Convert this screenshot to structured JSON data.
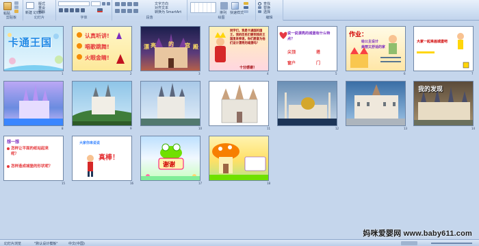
{
  "ribbon": {
    "groups": [
      "剪贴板",
      "幻灯片",
      "字体",
      "段落",
      "绘图",
      "编辑"
    ],
    "paste_label": "粘贴",
    "new_slide_label": "新建\n幻灯片",
    "layout_label": "版式",
    "reset_label": "重设",
    "delete_label": "删除",
    "font_name": "",
    "font_size": "",
    "text_direction_label": "文字方向",
    "align_text_label": "对齐文本",
    "smartart_label": "转换为 SmartArt",
    "shapes_label": "形状",
    "arrange_label": "排列",
    "quick_styles_label": "快速样式",
    "find_label": "查找",
    "replace_label": "替换",
    "select_label": "选择"
  },
  "slides": [
    {
      "num": "1",
      "title": "卡通王国"
    },
    {
      "num": "2",
      "texts": [
        "认真听讲!",
        "唱歌跳舞!",
        "火眼金睛!"
      ]
    },
    {
      "num": "3",
      "texts": [
        "漂",
        "亮",
        "的",
        "宫",
        "殿"
      ]
    },
    {
      "num": "4",
      "texts": [
        "同学们，我是卡通国的国王，我的臣民们要到我的王国里来参观，你们愿意为他们设计漂亮的城堡吗？",
        "十分感谢！"
      ]
    },
    {
      "num": "5",
      "texts": [
        "说一说漂亮的城堡有什么特点？",
        "尖顶",
        "塔",
        "窗户",
        "门"
      ]
    },
    {
      "num": "6",
      "texts": [
        "作业：",
        "给公主设计",
        "美丽又舒适的家"
      ]
    },
    {
      "num": "7",
      "texts": [
        "大家一起来画城堡吧"
      ]
    },
    {
      "num": "8"
    },
    {
      "num": "9"
    },
    {
      "num": "10"
    },
    {
      "num": "11"
    },
    {
      "num": "12"
    },
    {
      "num": "13"
    },
    {
      "num": "14",
      "texts": [
        "我的发现"
      ]
    },
    {
      "num": "15",
      "texts": [
        "想一想",
        "怎样让平面的纸站起来呢？",
        "怎样造成城堡的形状呢？"
      ]
    },
    {
      "num": "16",
      "texts": [
        "大家你来说说",
        "真棒！"
      ]
    },
    {
      "num": "17",
      "texts": [
        "谢谢"
      ]
    },
    {
      "num": "18"
    }
  ],
  "status": {
    "view": "幻灯片浏览",
    "theme": "\"默认设计模板\"",
    "language": "中文(中国)"
  },
  "watermark": "妈咪爱婴网 www.baby611.com",
  "colors": {
    "ribbon_bg": "#cfdff3",
    "sorter_bg": "#c5d6ec",
    "accent": "#3b5478"
  }
}
